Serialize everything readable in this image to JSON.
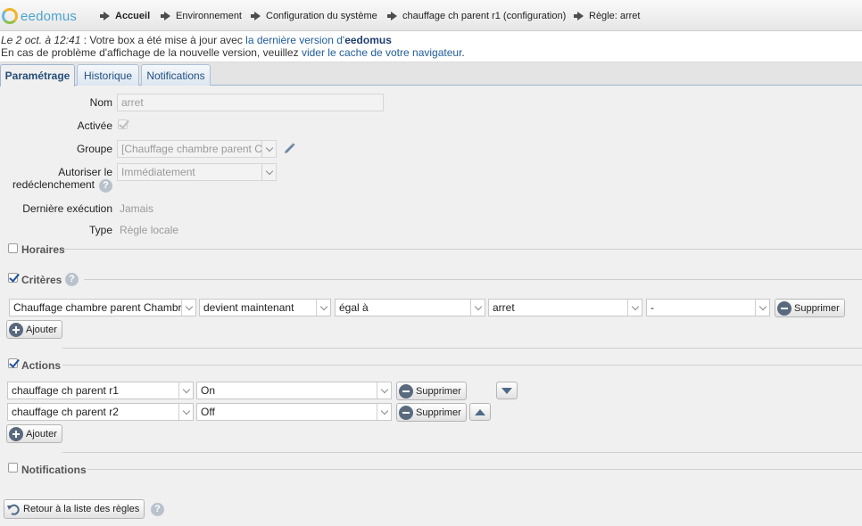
{
  "logo": {
    "text": "eedomus"
  },
  "breadcrumb": [
    {
      "label": "Accueil"
    },
    {
      "label": "Environnement"
    },
    {
      "label": "Configuration du système"
    },
    {
      "label": "chauffage ch parent r1 (configuration)"
    },
    {
      "label": "Règle: arret"
    }
  ],
  "notice": {
    "date": "Le 2 oct. à 12:41",
    "text1": " : Votre box a été mise à jour avec ",
    "link1": "la dernière version d'",
    "brand": "eedomus",
    "text2": "En cas de problème d'affichage de la nouvelle version, veuillez ",
    "link2": "vider le cache de votre navigateur",
    "text3": "."
  },
  "tabs": [
    {
      "label": "Paramétrage",
      "active": true
    },
    {
      "label": "Historique",
      "active": false
    },
    {
      "label": "Notifications",
      "active": false
    }
  ],
  "form": {
    "nom_label": "Nom",
    "nom_value": "arret",
    "activee_label": "Activée",
    "groupe_label": "Groupe",
    "groupe_value": "[Chauffage chambre parent C",
    "retrigger_label_1": "Autoriser le",
    "retrigger_label_2": "redéclenchement",
    "retrigger_value": "Immédiatement",
    "last_exec_label": "Dernière exécution",
    "last_exec_value": "Jamais",
    "type_label": "Type",
    "type_value": "Règle locale"
  },
  "sections": {
    "horaires": "Horaires",
    "criteres": "Critères",
    "actions": "Actions",
    "notifications": "Notifications"
  },
  "criteria": {
    "row": {
      "device": "Chauffage chambre parent Chambr",
      "condition": "devient maintenant",
      "operator": "égal à",
      "value": "arret",
      "extra": "-"
    },
    "delete_label": "Supprimer",
    "add_label": "Ajouter"
  },
  "actions": {
    "rows": [
      {
        "device": "chauffage ch parent r1",
        "value": "On"
      },
      {
        "device": "chauffage ch parent r2",
        "value": "Off"
      }
    ],
    "delete_label": "Supprimer",
    "add_label": "Ajouter"
  },
  "footer": {
    "back_label": "Retour à la liste des règles"
  },
  "colors": {
    "link": "#1f5c99",
    "tab_text": "#1f4f82",
    "logo": "#4ba3cf"
  }
}
